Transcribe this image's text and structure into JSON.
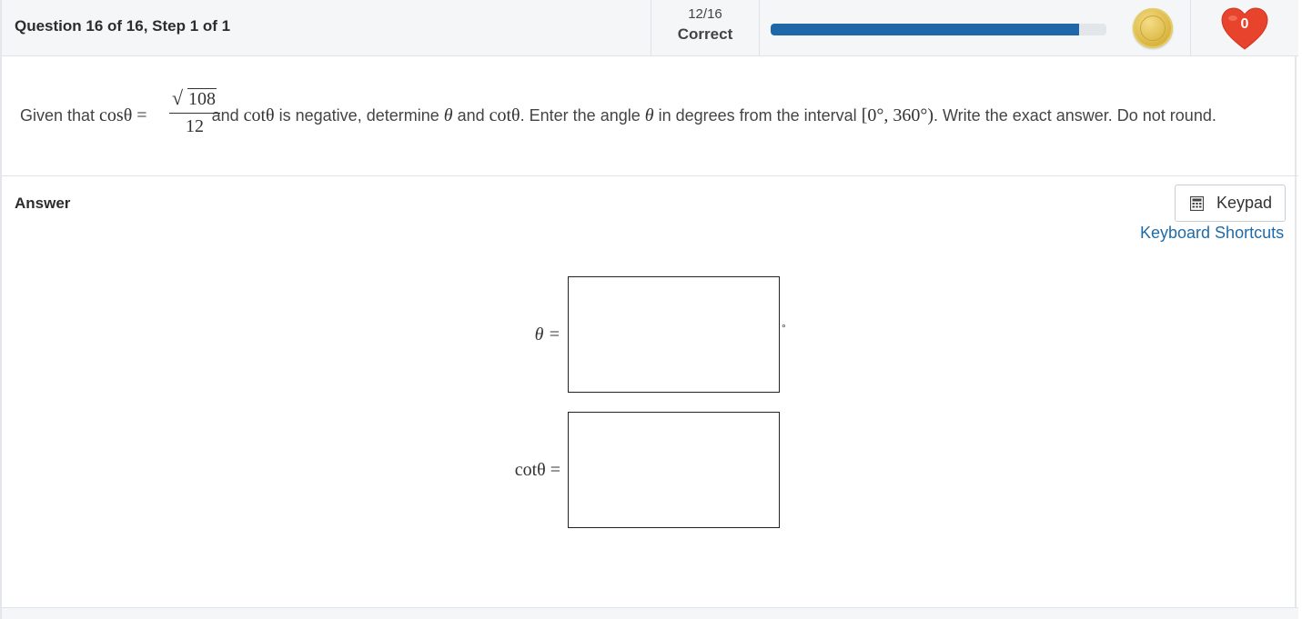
{
  "header": {
    "question_title": "Question 16 of 16, Step 1 of 1",
    "score_fraction": "12/16",
    "score_label": "Correct",
    "progress_fraction": 0.92,
    "hearts": "0"
  },
  "question": {
    "text_before": "Given that ",
    "cos_expr": "cosθ =",
    "frac_radicand": "108",
    "frac_denominator": "12",
    "text_mid1": " and ",
    "cot_expr": "cotθ",
    "text_mid2": " is negative, determine ",
    "theta": "θ",
    "text_mid3": " and ",
    "cot_expr2": "cotθ",
    "text_mid4": ". Enter the angle ",
    "theta2": "θ",
    "text_mid5": " in degrees from the interval ",
    "interval": "[0°, 360°)",
    "text_end": ". Write the exact answer. Do not round."
  },
  "answer": {
    "label": "Answer",
    "keypad_label": "Keypad",
    "shortcuts_label": "Keyboard Shortcuts",
    "theta_label": "θ =",
    "degree_symbol": "°",
    "cot_label": "cotθ ="
  },
  "colors": {
    "progress": "#1e67a8",
    "heart": "#e8432c",
    "link": "#1e6ba8"
  }
}
